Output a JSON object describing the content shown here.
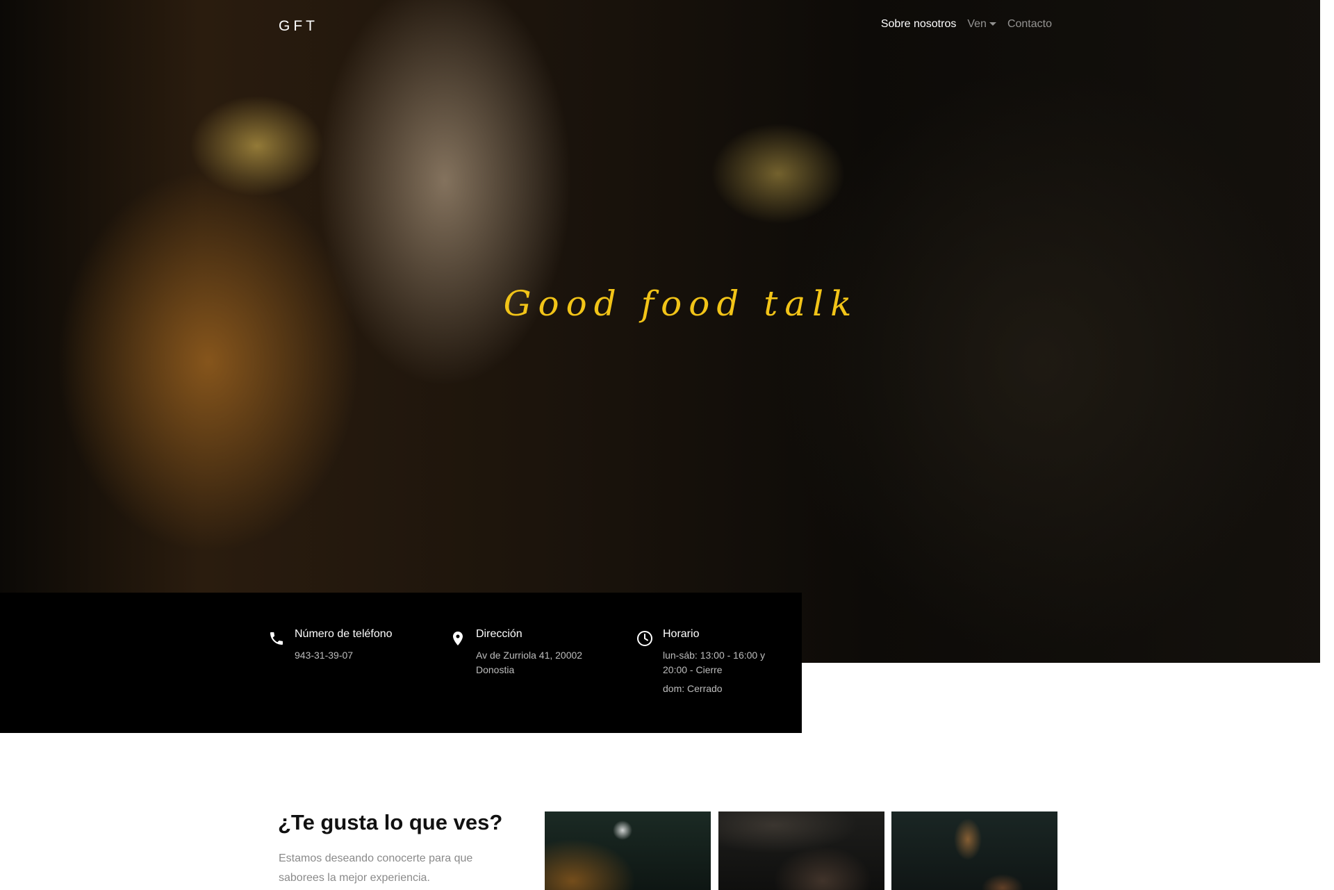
{
  "nav": {
    "brand": "GFT",
    "items": [
      {
        "label": "Sobre nosotros"
      },
      {
        "label": "Ven"
      },
      {
        "label": "Contacto"
      }
    ]
  },
  "hero": {
    "tagline": "Good food talk"
  },
  "info": {
    "phone": {
      "title": "Número de teléfono",
      "value": "943-31-39-07",
      "icon": "phone-icon"
    },
    "address": {
      "title": "Dirección",
      "line1": "Av de Zurriola 41, 20002",
      "line2": "Donostia",
      "icon": "map-pin-icon"
    },
    "hours": {
      "title": "Horario",
      "line1": "lun-sáb: 13:00 - 16:00 y",
      "line2": "20:00 - Cierre",
      "line3": "dom: Cerrado",
      "icon": "clock-icon"
    }
  },
  "cta": {
    "title": "¿Te gusta lo que ves?",
    "text": "Estamos deseando conocerte para que saborees la mejor experiencia."
  },
  "colors": {
    "accent": "#f2c418",
    "info_bg": "#000000"
  }
}
